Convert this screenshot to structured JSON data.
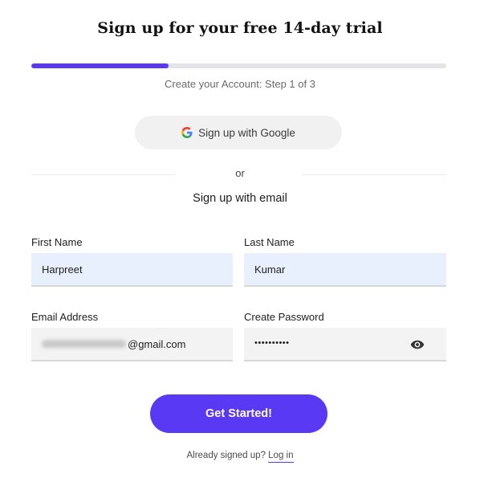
{
  "header": {
    "title": "Sign up for your free 14-day trial",
    "progress_fraction": 0.33,
    "step_text": "Create your Account: Step 1 of 3"
  },
  "google": {
    "label": "Sign up with Google",
    "icon": "google-icon"
  },
  "divider": {
    "or_text": "or"
  },
  "email_section": {
    "heading": "Sign up with email"
  },
  "form": {
    "first_name": {
      "label": "First Name",
      "value": "Harpreet"
    },
    "last_name": {
      "label": "Last Name",
      "value": "Kumar"
    },
    "email": {
      "label": "Email Address",
      "visible_suffix": "@gmail.com"
    },
    "password": {
      "label": "Create Password",
      "masked_value": "••••••••••",
      "toggle_icon": "eye-icon"
    }
  },
  "actions": {
    "submit_label": "Get Started!",
    "already_text": "Already signed up?",
    "login_label": "Log in"
  },
  "colors": {
    "accent": "#5a39f5",
    "autofill_bg": "#e8f0fe",
    "field_bg": "#f3f3f3"
  }
}
